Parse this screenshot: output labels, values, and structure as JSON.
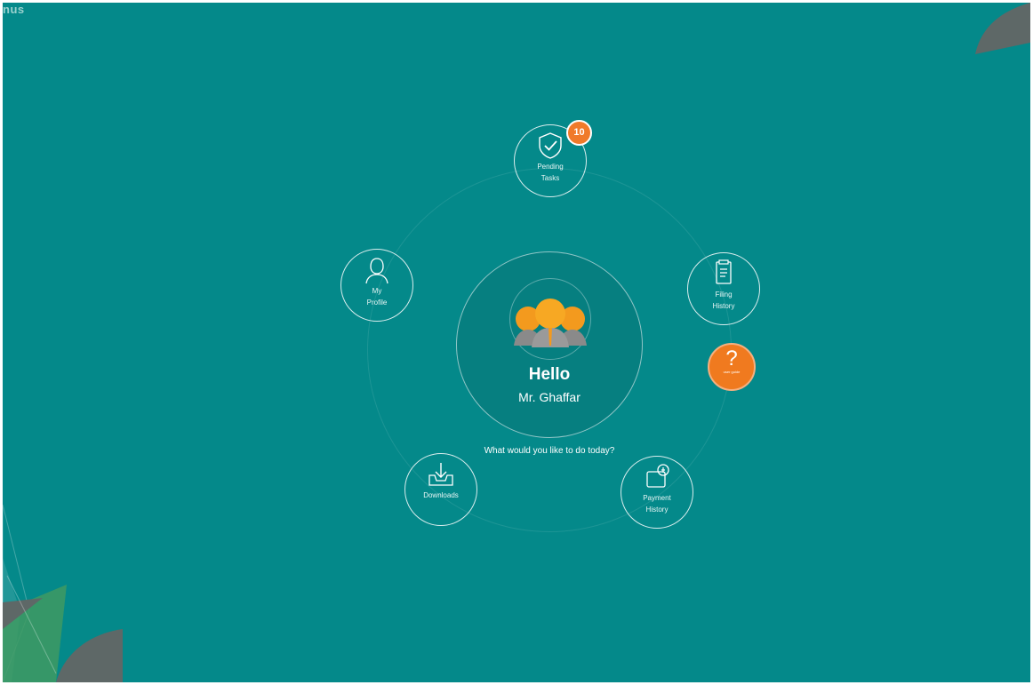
{
  "brand": {
    "text": "nus"
  },
  "center": {
    "greeting": "Hello",
    "user_name": "Mr. Ghaffar",
    "prompt": "What would you like to do today?"
  },
  "nodes": {
    "pending_tasks": {
      "label": "Pending\nTasks",
      "badge": "10",
      "icon": "check-shield-icon"
    },
    "my_profile": {
      "label": "My\nProfile",
      "icon": "person-icon"
    },
    "filing_history": {
      "label": "Filing\nHistory",
      "icon": "document-icon"
    },
    "payment_history": {
      "label": "Payment\nHistory",
      "icon": "wallet-icon"
    },
    "downloads": {
      "label": "Downloads",
      "icon": "download-tray-icon"
    }
  },
  "help": {
    "symbol": "?",
    "label": "user guide",
    "icon": "question-icon"
  },
  "colors": {
    "background": "#04898a",
    "accent": "#f07a2a",
    "avatar": "#f39a1e"
  }
}
